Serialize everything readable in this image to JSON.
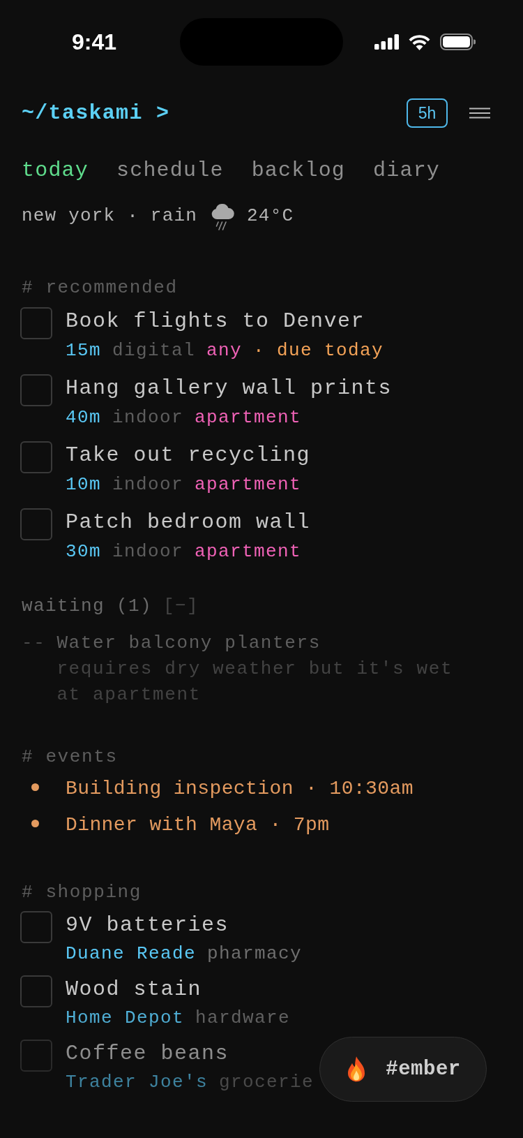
{
  "status_bar": {
    "time": "9:41"
  },
  "header": {
    "title": "~/taskami >",
    "budget": "5h"
  },
  "tabs": [
    {
      "label": "today",
      "selected": true
    },
    {
      "label": "schedule",
      "selected": false
    },
    {
      "label": "backlog",
      "selected": false
    },
    {
      "label": "diary",
      "selected": false
    }
  ],
  "weather": {
    "summary": "new york · rain",
    "temperature": "24°C"
  },
  "recommended": {
    "heading": "# recommended",
    "tasks": [
      {
        "title": "Book flights to Denver",
        "checked": false,
        "duration": "15m",
        "category": "digital",
        "location": "any",
        "due": "· due today"
      },
      {
        "title": "Hang gallery wall prints",
        "checked": false,
        "duration": "40m",
        "category": "indoor",
        "location": "apartment"
      },
      {
        "title": "Take out recycling",
        "checked": false,
        "duration": "10m",
        "category": "indoor",
        "location": "apartment"
      },
      {
        "title": "Patch bedroom wall",
        "checked": false,
        "duration": "30m",
        "category": "indoor",
        "location": "apartment"
      }
    ]
  },
  "waiting": {
    "heading": "waiting (1)",
    "toggle": "[−]",
    "items": [
      {
        "marker": "--",
        "title": "Water balcony planters",
        "reason": "requires dry weather but it's wet at apartment"
      }
    ]
  },
  "events": {
    "heading": "# events",
    "items": [
      {
        "text": "Building inspection · 10:30am"
      },
      {
        "text": "Dinner with Maya · 7pm"
      }
    ]
  },
  "shopping": {
    "heading": "# shopping",
    "items": [
      {
        "title": "9V batteries",
        "checked": false,
        "store": "Duane Reade",
        "category": "pharmacy"
      },
      {
        "title": "Wood stain",
        "checked": false,
        "store": "Home Depot",
        "category": "hardware"
      },
      {
        "title": "Coffee beans",
        "checked": false,
        "store": "Trader Joe's",
        "category": "grocerie"
      }
    ]
  },
  "tag_button": {
    "label": "#ember"
  }
}
